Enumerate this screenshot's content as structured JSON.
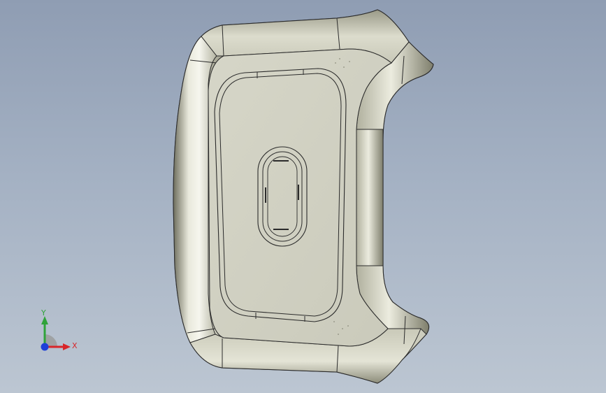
{
  "viewport": {
    "background_top": "#8f9db3",
    "background_bottom": "#bcc6d2"
  },
  "model": {
    "part": "steering-wheel-airbag-cover",
    "face_color": "#d2d2c4",
    "rim_color": "#c7c7b6",
    "edge_color": "#2b2b2b"
  },
  "triad": {
    "x_label": "X",
    "y_label": "Y",
    "x_color": "#d8262a",
    "y_color": "#2fa33a",
    "z_color": "#1f3fd8"
  }
}
